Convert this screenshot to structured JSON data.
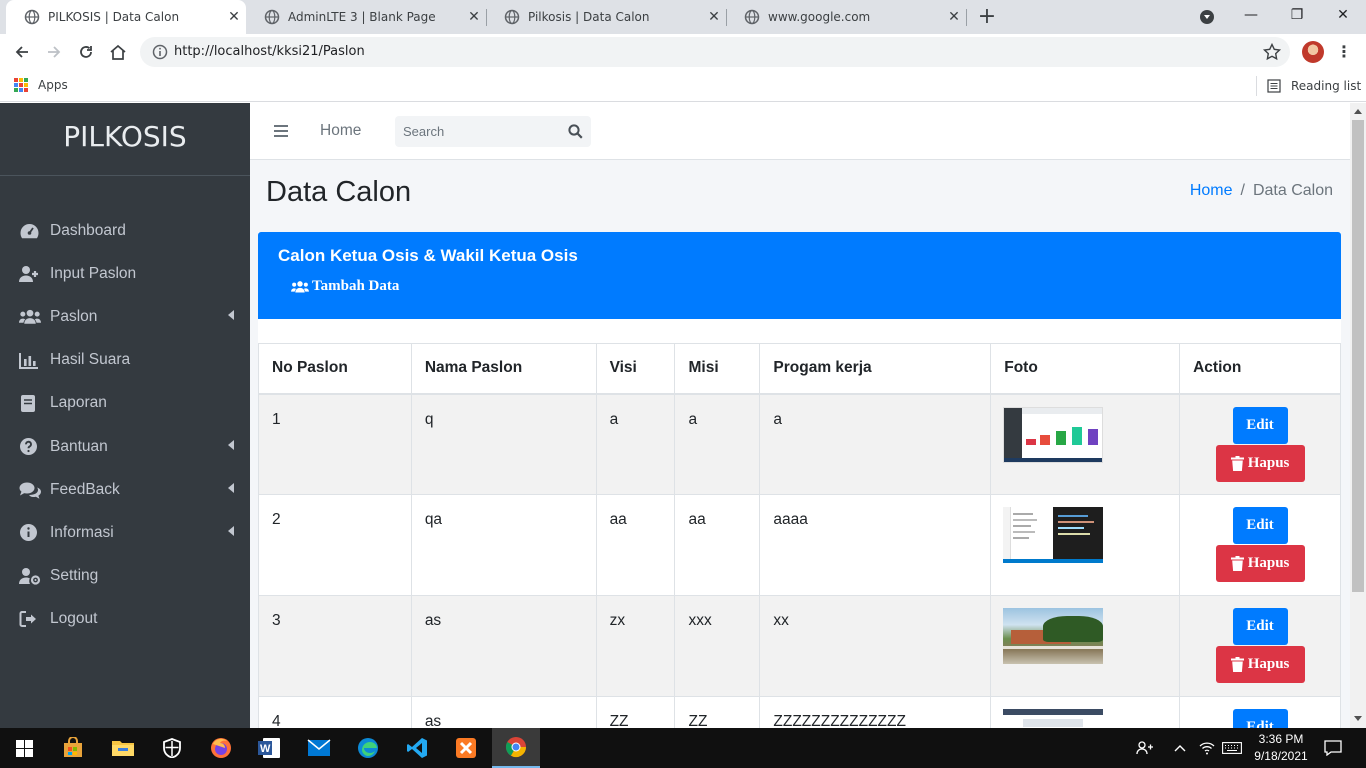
{
  "browser": {
    "tabs": [
      {
        "title": "PILKOSIS | Data Calon",
        "active": true
      },
      {
        "title": "AdminLTE 3 | Blank Page",
        "active": false
      },
      {
        "title": "Pilkosis | Data Calon",
        "active": false
      },
      {
        "title": "www.google.com",
        "active": false
      }
    ],
    "url": "http://localhost/kksi21/Paslon",
    "bookmarks": {
      "apps_label": "Apps",
      "reading_list_label": "Reading list"
    }
  },
  "sidebar": {
    "brand": "PILKOSIS",
    "items": [
      {
        "label": "Dashboard",
        "icon": "tachometer-icon",
        "has_submenu": false
      },
      {
        "label": "Input Paslon",
        "icon": "user-plus-icon",
        "has_submenu": false
      },
      {
        "label": "Paslon",
        "icon": "users-icon",
        "has_submenu": true
      },
      {
        "label": "Hasil Suara",
        "icon": "bar-chart-icon",
        "has_submenu": false
      },
      {
        "label": "Laporan",
        "icon": "book-icon",
        "has_submenu": false
      },
      {
        "label": "Bantuan",
        "icon": "question-circle-icon",
        "has_submenu": true
      },
      {
        "label": "FeedBack",
        "icon": "comments-icon",
        "has_submenu": true
      },
      {
        "label": "Informasi",
        "icon": "info-circle-icon",
        "has_submenu": true
      },
      {
        "label": "Setting",
        "icon": "user-cog-icon",
        "has_submenu": false
      },
      {
        "label": "Logout",
        "icon": "sign-out-icon",
        "has_submenu": false
      }
    ]
  },
  "topnav": {
    "home_label": "Home",
    "search_placeholder": "Search"
  },
  "header": {
    "title": "Data Calon",
    "breadcrumb": {
      "home": "Home",
      "separator": "/",
      "current": "Data Calon"
    }
  },
  "card": {
    "title": "Calon Ketua Osis & Wakil Ketua Osis",
    "add_button": "Tambah Data"
  },
  "table": {
    "columns": [
      "No Paslon",
      "Nama Paslon",
      "Visi",
      "Misi",
      "Progam kerja",
      "Foto",
      "Action"
    ],
    "rows": [
      {
        "no": "1",
        "nama": "q",
        "visi": "a",
        "misi": "a",
        "program": "a",
        "foto": "dashboard-screenshot"
      },
      {
        "no": "2",
        "nama": "qa",
        "visi": "aa",
        "misi": "aa",
        "program": "aaaa",
        "foto": "code-editor-screenshot"
      },
      {
        "no": "3",
        "nama": "as",
        "visi": "zx",
        "misi": "xxx",
        "program": "xx",
        "foto": "school-building-photo"
      },
      {
        "no": "4",
        "nama": "as",
        "visi": "ZZ",
        "misi": "ZZ",
        "program": "ZZZZZZZZZZZZZZ",
        "foto": "webpage-screenshot"
      }
    ],
    "edit_label": "Edit",
    "delete_label": "Hapus"
  },
  "taskbar": {
    "time": "3:36 PM",
    "date": "9/18/2021"
  },
  "colors": {
    "primary": "#007bff",
    "danger": "#dc3545",
    "sidebar": "#343a40"
  }
}
